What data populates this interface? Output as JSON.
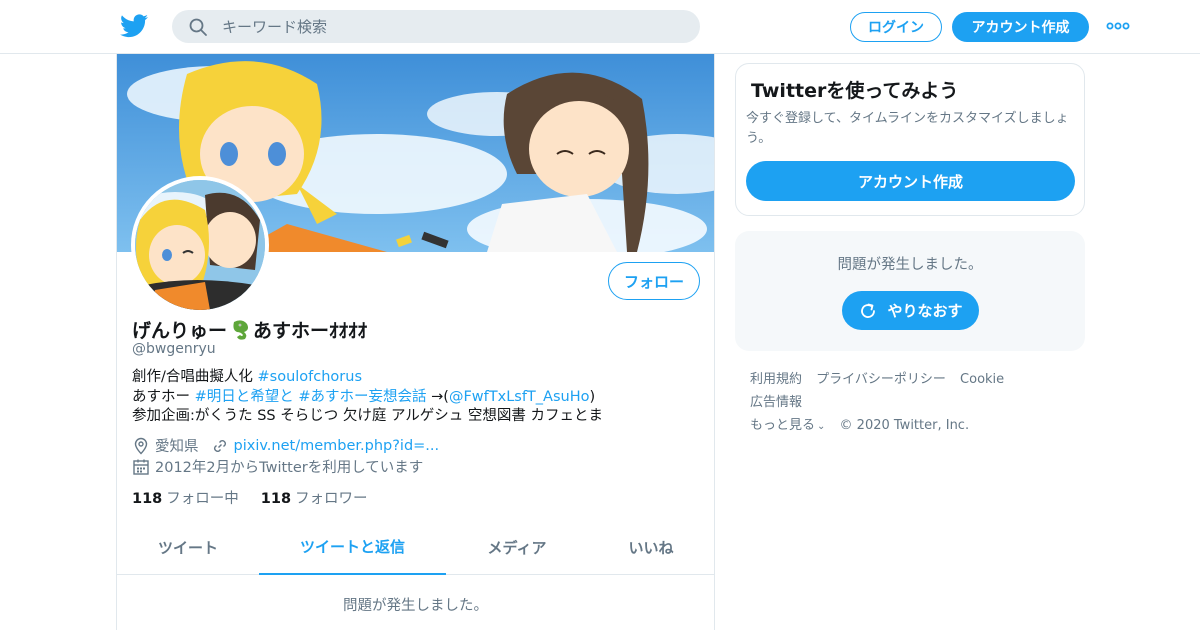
{
  "header": {
    "search_placeholder": "キーワード検索",
    "login_label": "ログイン",
    "signup_label": "アカウント作成"
  },
  "profile": {
    "name_prefix": "げんりゅー",
    "name_suffix": "あすホーｵｵｵｵ",
    "handle": "@bwgenryu",
    "follow_label": "フォロー",
    "bio": {
      "line1_text": "創作/合唱曲擬人化 ",
      "line1_tag": "#soulofchorus",
      "line2_text": "あすホー ",
      "line2_tag1": "#明日と希望と",
      "line2_tag2": "#あすホー妄想会話",
      "line2_arrow": " →(",
      "line2_mention": "@FwfTxLsfT_AsuHo",
      "line2_close": ")",
      "line3_text": "参加企画:がくうた SS そらじつ 欠け庭 アルゲシュ 空想図書 カフェとま"
    },
    "location": "愛知県",
    "website": "pixiv.net/member.php?id=...",
    "joined": "2012年2月からTwitterを利用しています",
    "following_count": "118",
    "following_label": "フォロー中",
    "followers_count": "118",
    "followers_label": "フォロワー"
  },
  "tabs": [
    {
      "label": "ツイート"
    },
    {
      "label": "ツイートと返信"
    },
    {
      "label": "メディア"
    },
    {
      "label": "いいね"
    }
  ],
  "main_error": "問題が発生しました。",
  "signup_card": {
    "title": "Twitterを使ってみよう",
    "description": "今すぐ登録して、タイムラインをカスタマイズしましょう。",
    "button_label": "アカウント作成"
  },
  "error_card": {
    "text": "問題が発生しました。",
    "retry_label": "やりなおす"
  },
  "footer": {
    "links": [
      "利用規約",
      "プライバシーポリシー",
      "Cookie",
      "広告情報",
      "もっと見る"
    ],
    "copyright": "© 2020 Twitter, Inc."
  },
  "colors": {
    "accent": "#1da1f2",
    "secondary_text": "#657786",
    "border": "#e1e8ed"
  },
  "icons": [
    "twitter-logo-icon",
    "search-icon",
    "more-icon",
    "dragon-emoji-icon",
    "location-icon",
    "link-icon",
    "calendar-icon",
    "retry-icon",
    "chevron-down-icon"
  ]
}
